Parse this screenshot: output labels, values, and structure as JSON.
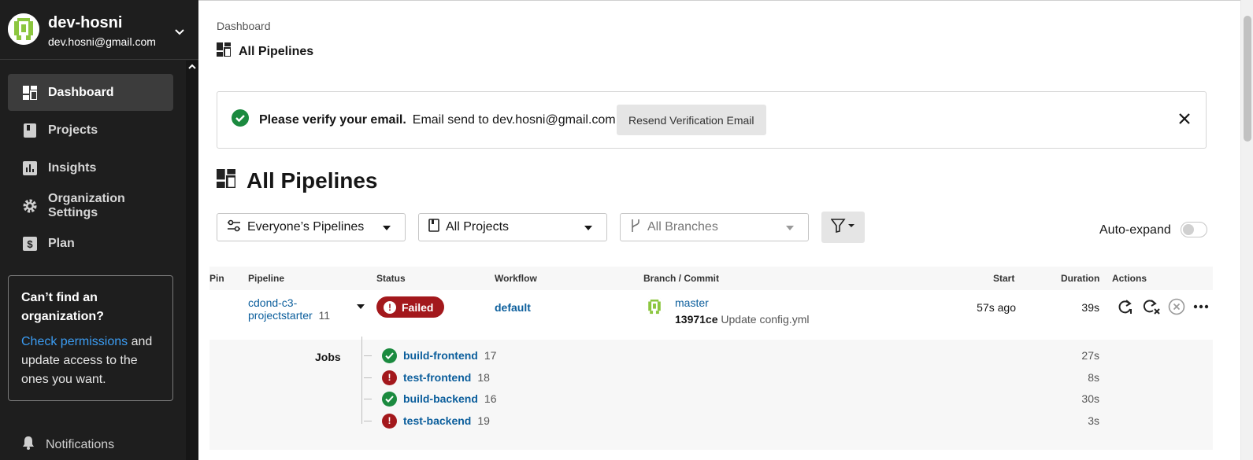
{
  "user": {
    "name": "dev-hosni",
    "email": "dev.hosni@gmail.com"
  },
  "sidebar": {
    "items": [
      {
        "label": "Dashboard",
        "icon": "dashboard-icon",
        "active": true
      },
      {
        "label": "Projects",
        "icon": "book-icon"
      },
      {
        "label": "Insights",
        "icon": "bar-chart-icon"
      },
      {
        "label": "Organization Settings",
        "icon": "gear-icon"
      },
      {
        "label": "Plan",
        "icon": "dollar-icon"
      }
    ],
    "org_box": {
      "title": "Can’t find an organization?",
      "link": "Check permissions",
      "body": " and update access to the ones you want."
    },
    "notifications": "Notifications"
  },
  "breadcrumb": "Dashboard",
  "subtitle": "All Pipelines",
  "banner": {
    "title": "Please verify your email.",
    "text": "Email send to dev.hosni@gmail.com.",
    "button": "Resend Verification Email"
  },
  "page_title": "All Pipelines",
  "filters": {
    "pipelines": "Everyone’s Pipelines",
    "projects": "All Projects",
    "branches": "All Branches",
    "auto_expand": "Auto-expand"
  },
  "table": {
    "headers": [
      "Pin",
      "Pipeline",
      "Status",
      "Workflow",
      "Branch / Commit",
      "Start",
      "Duration",
      "Actions"
    ],
    "row": {
      "pipeline_line1": "cdond-c3-",
      "pipeline_line2": "projectstarter",
      "pipeline_number": "11",
      "status": "Failed",
      "workflow": "default",
      "branch": "master",
      "commit_hash": "13971ce",
      "commit_msg": "Update config.yml",
      "start": "57s ago",
      "duration": "39s"
    },
    "jobs_label": "Jobs",
    "jobs": [
      {
        "name": "build-frontend",
        "number": "17",
        "status": "success",
        "duration": "27s"
      },
      {
        "name": "test-frontend",
        "number": "18",
        "status": "failed",
        "duration": "8s"
      },
      {
        "name": "build-backend",
        "number": "16",
        "status": "success",
        "duration": "30s"
      },
      {
        "name": "test-backend",
        "number": "19",
        "status": "failed",
        "duration": "3s"
      }
    ]
  },
  "colors": {
    "sidebar_bg": "#1e1e1e",
    "failed": "#a3181c",
    "success": "#1b8a3f",
    "link": "#0b5e9c"
  }
}
